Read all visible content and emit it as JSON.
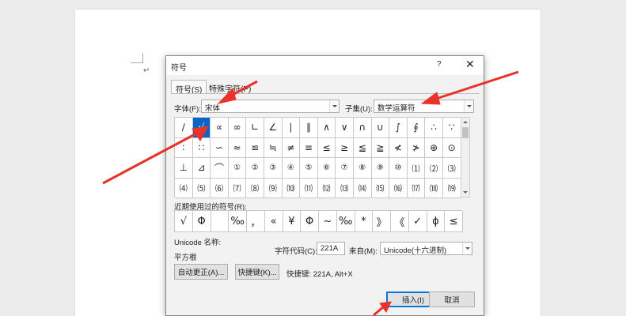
{
  "dialog": {
    "title": "符号",
    "help": "?",
    "close": "✕"
  },
  "tabs": [
    {
      "label": "符号(S)"
    },
    {
      "label": "特殊字符(P)"
    }
  ],
  "font": {
    "label": "字体(F):",
    "value": "宋体"
  },
  "subset": {
    "label": "子集(U):",
    "value": "数学运算符"
  },
  "symbols": [
    [
      "∕",
      "√",
      "∝",
      "∞",
      "∟",
      "∠",
      "∣",
      "∥",
      "∧",
      "∨",
      "∩",
      "∪",
      "∫",
      "∮",
      "∴",
      "∵"
    ],
    [
      "∶",
      "∷",
      "∽",
      "≈",
      "≌",
      "≒",
      "≠",
      "≡",
      "≤",
      "≥",
      "≦",
      "≧",
      "≮",
      "≯",
      "⊕",
      "⊙"
    ],
    [
      "⊥",
      "⊿",
      "⌒",
      "①",
      "②",
      "③",
      "④",
      "⑤",
      "⑥",
      "⑦",
      "⑧",
      "⑨",
      "⑩",
      "⑴",
      "⑵",
      "⑶"
    ],
    [
      "⑷",
      "⑸",
      "⑹",
      "⑺",
      "⑻",
      "⑼",
      "⑽",
      "⑾",
      "⑿",
      "⒀",
      "⒁",
      "⒂",
      "⒃",
      "⒄",
      "⒅",
      "⒆"
    ]
  ],
  "recent": {
    "label": "近期使用过的符号(R):",
    "items": [
      "√",
      "Φ",
      "",
      "‰",
      "，",
      "«",
      "¥",
      "Φ",
      "~",
      "‰",
      "*",
      "》",
      "《",
      "✓",
      "ϕ",
      "≤"
    ]
  },
  "unicode_name": {
    "label": "Unicode 名称:",
    "value": "平方根"
  },
  "char_code": {
    "label": "字符代码(C):",
    "value": "221A"
  },
  "from": {
    "label": "来自(M):",
    "value": "Unicode(十六进制)"
  },
  "buttons": {
    "autocorrect": "自动更正(A)...",
    "shortcut_key": "快捷键(K)...",
    "shortcut_info": "快捷键: 221A, Alt+X",
    "insert": "插入(I)",
    "cancel": "取消"
  },
  "doc": {
    "paragraph_mark": "↵"
  },
  "colors": {
    "selection": "#0a64c8",
    "annotation_arrow": "#e8322a"
  }
}
